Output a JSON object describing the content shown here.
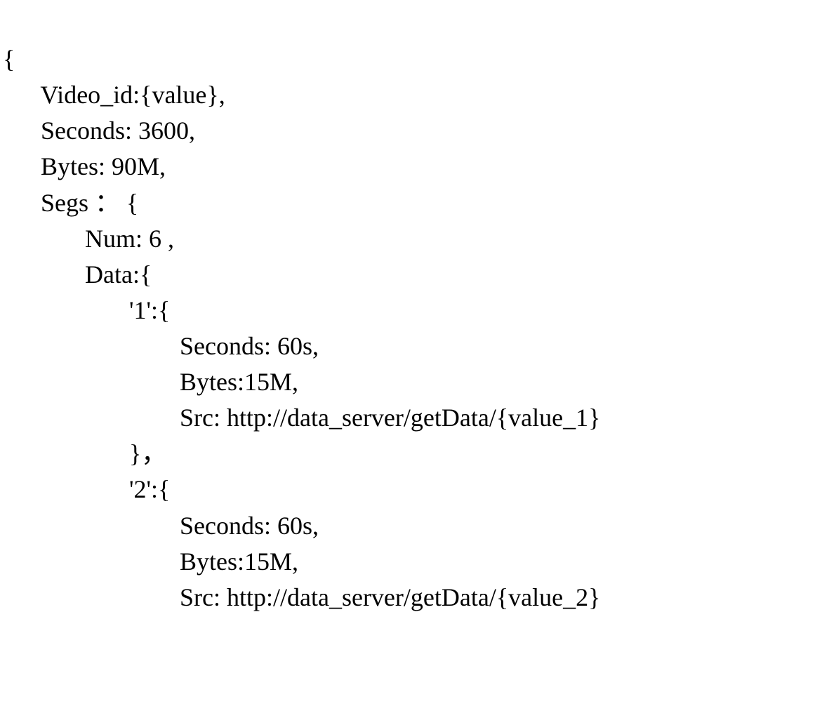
{
  "lines": [
    "{",
    "      Video_id:{value},",
    "      Seconds: 3600,",
    "      Bytes: 90M,",
    "      Segs ： {",
    "             Num: 6 ,",
    "             Data:{",
    "                    '1':{",
    "                            Seconds: 60s,",
    "                            Bytes:15M,",
    "                            Src: http://data_server/getData/{value_1}",
    "                    }，",
    "                    '2':{",
    "                            Seconds: 60s,",
    "                            Bytes:15M,",
    "                            Src: http://data_server/getData/{value_2}"
  ]
}
